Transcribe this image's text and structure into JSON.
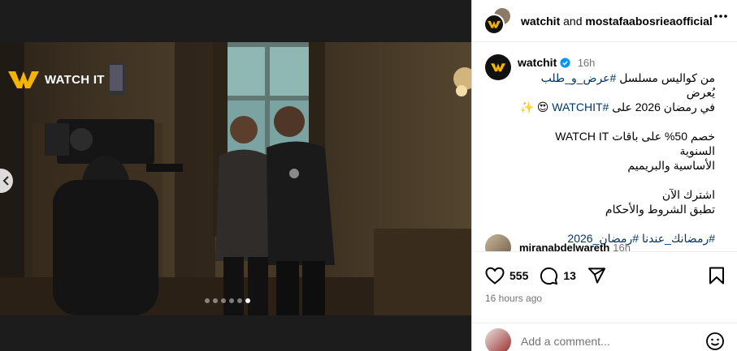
{
  "header": {
    "user1": "watchit",
    "and": "and",
    "user2": "mostafaabosrieaofficial"
  },
  "media": {
    "watermark": "WATCH IT",
    "slide_count": 6,
    "active_slide": 6
  },
  "caption": {
    "user": "watchit",
    "time": "16h",
    "line1_pre": "من كواليس مسلسل ",
    "line1_tag": "#عرض_و_طلب",
    "line1_post": " يُعرض",
    "line2_pre": "في رمضان 2026 على ",
    "line2_tag": "#WATCHIT",
    "line2_post": " 😍 ✨",
    "line3": "خصم 50% على باقات WATCH IT السنوية",
    "line4": "الأساسية والبريميم",
    "line5": "اشترك الآن",
    "line6": "تطبق الشروط والأحكام",
    "hashtags": "#رمضانك_عندنا #رمضان_2026"
  },
  "comment": {
    "user": "miranabdelwareth",
    "time": "16h"
  },
  "actions": {
    "likes": "555",
    "comments": "13",
    "time_ago": "16 hours ago"
  },
  "compose": {
    "placeholder": "Add a comment..."
  },
  "colors": {
    "brand_yellow": "#f5b400",
    "link": "#00376b",
    "verified": "#0095f6"
  }
}
